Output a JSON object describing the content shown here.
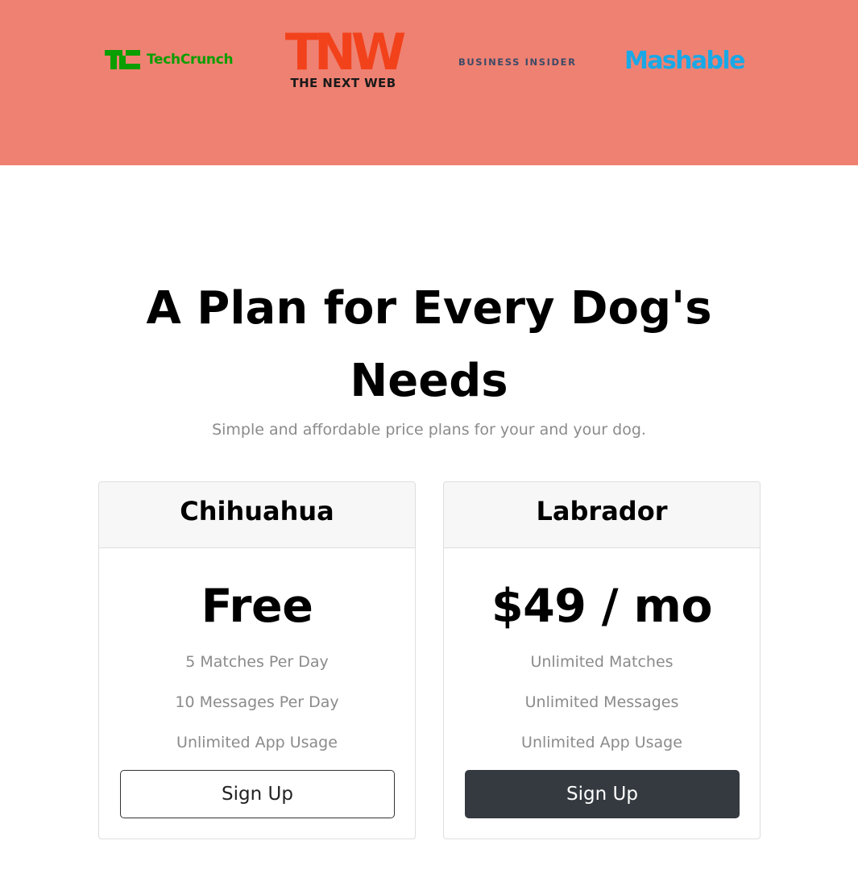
{
  "press": {
    "techcrunch": {
      "text": "TechCrunch",
      "color": "#0a9e01"
    },
    "tnw": {
      "letters": "TNW",
      "subtitle": "THE NEXT WEB",
      "color": "#f2421b"
    },
    "business_insider": {
      "text": "BUSINESS INSIDER",
      "color": "#3c4a66"
    },
    "mashable": {
      "text": "Mashable",
      "color": "#1aa8e6"
    },
    "background_color": "#ef8172"
  },
  "pricing": {
    "title": "A Plan for Every Dog's Needs",
    "subtitle": "Simple and affordable price plans for your and your dog.",
    "plans": [
      {
        "name": "Chihuahua",
        "price": "Free",
        "features": [
          "5 Matches Per Day",
          "10 Messages Per Day",
          "Unlimited App Usage"
        ],
        "button_label": "Sign Up",
        "button_style": "outline"
      },
      {
        "name": "Labrador",
        "price": "$49 / mo",
        "features": [
          "Unlimited Matches",
          "Unlimited Messages",
          "Unlimited App Usage"
        ],
        "button_label": "Sign Up",
        "button_style": "dark",
        "button_color": "#343a40"
      }
    ]
  }
}
